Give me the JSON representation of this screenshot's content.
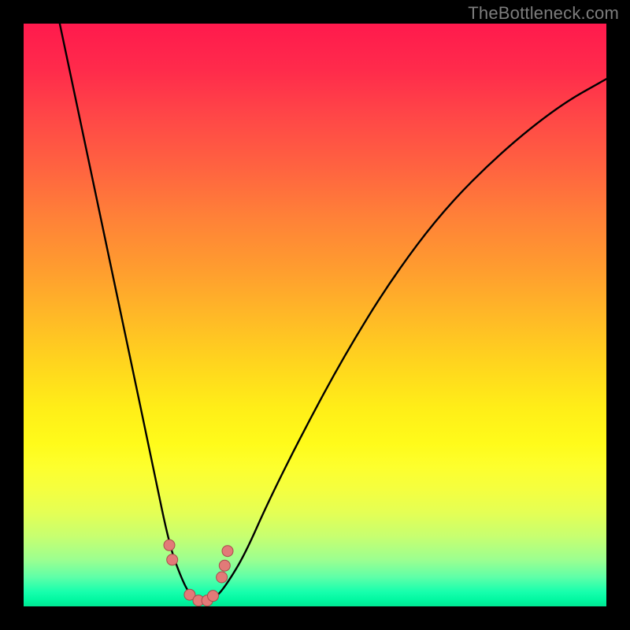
{
  "watermark": "TheBottleneck.com",
  "colors": {
    "background": "#000000",
    "gradient_top": "#ff1a4d",
    "gradient_bottom": "#00e693",
    "curve_stroke": "#000000",
    "marker_fill": "#e27a78",
    "marker_stroke": "#a84c4c",
    "watermark_text": "#7d7d7d"
  },
  "chart_data": {
    "type": "line",
    "title": "",
    "xlabel": "",
    "ylabel": "",
    "xlim": [
      0,
      1
    ],
    "ylim": [
      0,
      1
    ],
    "note": "V-shaped bottleneck curve; y=0 means no bottleneck (green). Minimum near x≈0.30. Axes are normalized and unlabeled.",
    "series": [
      {
        "name": "bottleneck-curve",
        "x": [
          0.062,
          0.1,
          0.14,
          0.18,
          0.22,
          0.25,
          0.27,
          0.285,
          0.3,
          0.315,
          0.33,
          0.35,
          0.38,
          0.42,
          0.48,
          0.55,
          0.63,
          0.72,
          0.82,
          0.92,
          1.0
        ],
        "y": [
          1.0,
          0.82,
          0.63,
          0.44,
          0.25,
          0.105,
          0.05,
          0.02,
          0.01,
          0.01,
          0.015,
          0.04,
          0.09,
          0.18,
          0.3,
          0.43,
          0.56,
          0.68,
          0.78,
          0.86,
          0.905
        ]
      }
    ],
    "markers": {
      "name": "highlighted-points",
      "note": "Small pink dots clustered around the trough of the curve",
      "x": [
        0.25,
        0.255,
        0.285,
        0.3,
        0.315,
        0.325,
        0.34,
        0.345,
        0.35
      ],
      "y": [
        0.105,
        0.08,
        0.02,
        0.01,
        0.01,
        0.018,
        0.05,
        0.07,
        0.095
      ]
    }
  }
}
